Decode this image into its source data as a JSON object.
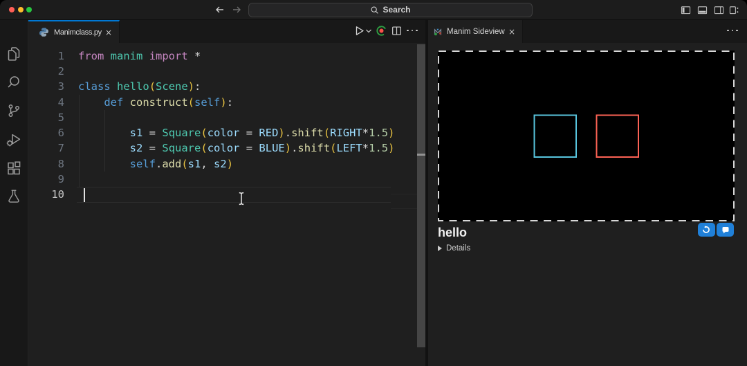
{
  "titlebar": {
    "search_label": "Search",
    "traffic_lights": {
      "red": "#FF5F57",
      "yellow": "#FEBC2E",
      "green": "#28C840"
    },
    "icons": [
      "back-arrow",
      "forward-arrow",
      "toggle-primary-sidebar",
      "toggle-panel",
      "toggle-secondary-sidebar",
      "customize-layout"
    ]
  },
  "activity_bar": {
    "items": [
      "explorer",
      "search",
      "source-control",
      "run-and-debug",
      "extensions",
      "testing"
    ]
  },
  "editor": {
    "tab": {
      "label": "Manimclass.py",
      "icon": "python",
      "close": "×",
      "accent": "#0078d4"
    },
    "actions": [
      "run-python-file",
      "run-dropdown",
      "manim-run-scene",
      "split-editor",
      "more-actions"
    ],
    "cursor_line": 10,
    "lines": [
      {
        "num": "1",
        "tokens": [
          [
            "kw",
            "from"
          ],
          [
            "pl",
            " "
          ],
          [
            "ty",
            "manim"
          ],
          [
            "pl",
            " "
          ],
          [
            "kw",
            "import"
          ],
          [
            "pl",
            " "
          ],
          [
            "op",
            "*"
          ]
        ]
      },
      {
        "num": "2",
        "tokens": []
      },
      {
        "num": "3",
        "tokens": [
          [
            "kw2",
            "class"
          ],
          [
            "pl",
            " "
          ],
          [
            "ty",
            "hello"
          ],
          [
            "br",
            "("
          ],
          [
            "ty",
            "Scene"
          ],
          [
            "br",
            ")"
          ],
          [
            "op",
            ":"
          ]
        ]
      },
      {
        "num": "4",
        "tokens": [
          [
            "pl",
            "    "
          ],
          [
            "kw2",
            "def"
          ],
          [
            "pl",
            " "
          ],
          [
            "fn",
            "construct"
          ],
          [
            "br",
            "("
          ],
          [
            "kw2",
            "self"
          ],
          [
            "br",
            ")"
          ],
          [
            "op",
            ":"
          ]
        ]
      },
      {
        "num": "5",
        "tokens": []
      },
      {
        "num": "6",
        "tokens": [
          [
            "pl",
            "        "
          ],
          [
            "var",
            "s1"
          ],
          [
            "pl",
            " "
          ],
          [
            "op",
            "="
          ],
          [
            "pl",
            " "
          ],
          [
            "ty",
            "Square"
          ],
          [
            "br",
            "("
          ],
          [
            "var",
            "color"
          ],
          [
            "pl",
            " "
          ],
          [
            "op",
            "="
          ],
          [
            "pl",
            " "
          ],
          [
            "var",
            "RED"
          ],
          [
            "br",
            ")"
          ],
          [
            "op",
            "."
          ],
          [
            "fn",
            "shift"
          ],
          [
            "br",
            "("
          ],
          [
            "var",
            "RIGHT"
          ],
          [
            "op",
            "*"
          ],
          [
            "num",
            "1.5"
          ],
          [
            "br",
            ")"
          ]
        ]
      },
      {
        "num": "7",
        "tokens": [
          [
            "pl",
            "        "
          ],
          [
            "var",
            "s2"
          ],
          [
            "pl",
            " "
          ],
          [
            "op",
            "="
          ],
          [
            "pl",
            " "
          ],
          [
            "ty",
            "Square"
          ],
          [
            "br",
            "("
          ],
          [
            "var",
            "color"
          ],
          [
            "pl",
            " "
          ],
          [
            "op",
            "="
          ],
          [
            "pl",
            " "
          ],
          [
            "var",
            "BLUE"
          ],
          [
            "br",
            ")"
          ],
          [
            "op",
            "."
          ],
          [
            "fn",
            "shift"
          ],
          [
            "br",
            "("
          ],
          [
            "var",
            "LEFT"
          ],
          [
            "op",
            "*"
          ],
          [
            "num",
            "1.5"
          ],
          [
            "br",
            ")"
          ]
        ]
      },
      {
        "num": "8",
        "tokens": [
          [
            "pl",
            "        "
          ],
          [
            "kw2",
            "self"
          ],
          [
            "op",
            "."
          ],
          [
            "fn",
            "add"
          ],
          [
            "br",
            "("
          ],
          [
            "var",
            "s1"
          ],
          [
            "op",
            ","
          ],
          [
            "pl",
            " "
          ],
          [
            "var",
            "s2"
          ],
          [
            "br",
            ")"
          ]
        ]
      },
      {
        "num": "9",
        "tokens": []
      },
      {
        "num": "10",
        "tokens": []
      }
    ],
    "token_colors": {
      "keyword": "#C586C0",
      "keyword2": "#569CD6",
      "type": "#4EC9B0",
      "function": "#DCDCAA",
      "variable": "#9CDCFE",
      "number": "#B5CEA8",
      "operator": "#D4D4D4",
      "bracket": "#E9C341"
    }
  },
  "sideview": {
    "tab": {
      "label": "Manim Sideview",
      "close": "×"
    },
    "scene_name": "hello",
    "details_label": "Details",
    "buttons": [
      "rerun-last-scene",
      "open-video-player"
    ],
    "preview": {
      "blue_square_color": "#58C4DD",
      "red_square_color": "#FC6255",
      "background": "#000000",
      "border_style": "dashed-white"
    },
    "button_color": "#2080D8"
  }
}
